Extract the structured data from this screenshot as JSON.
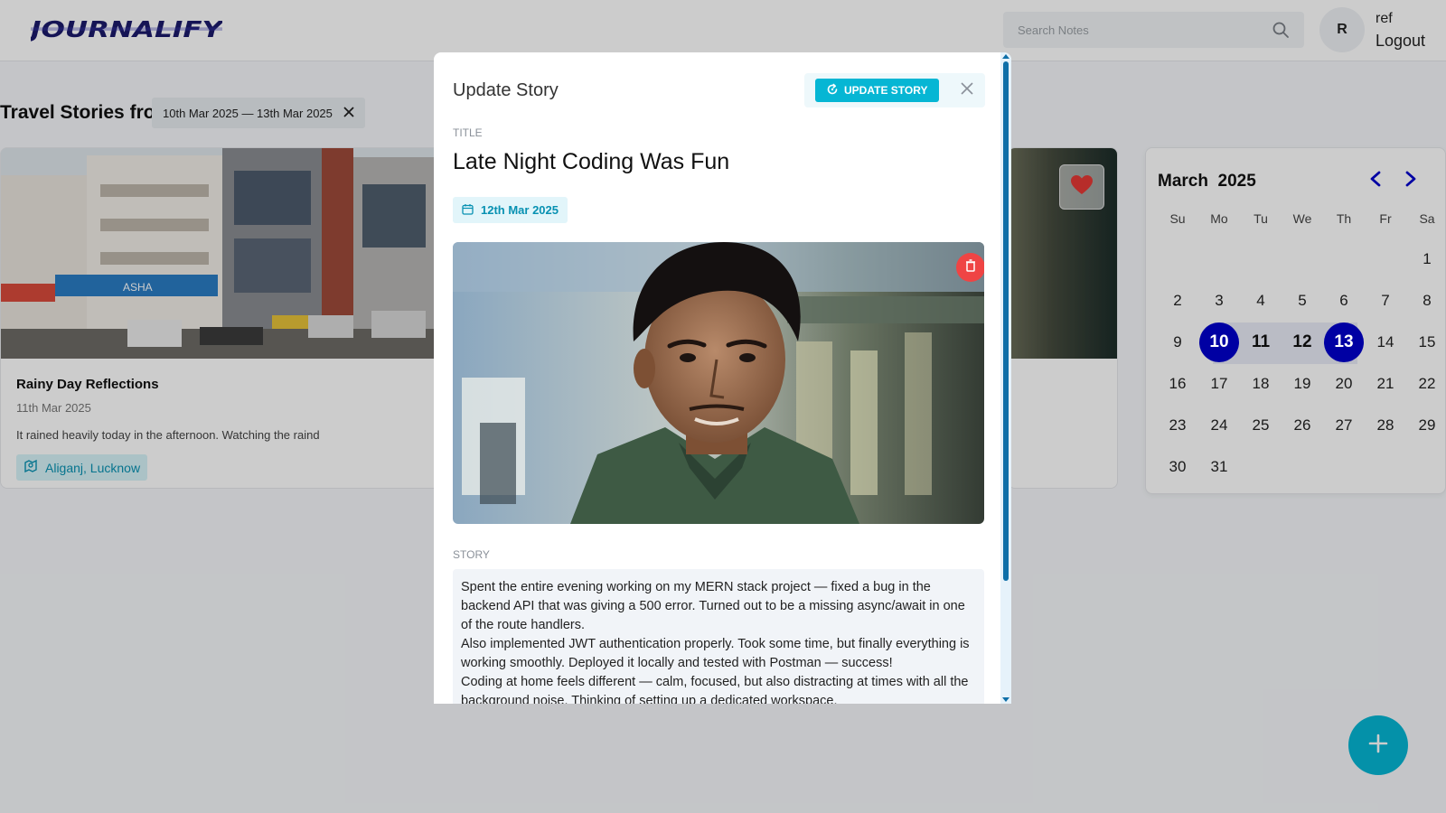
{
  "navbar": {
    "logo": "JOURNALIFY",
    "search_placeholder": "Search Notes",
    "avatar_initial": "R",
    "user_name": "ref",
    "logout_label": "Logout"
  },
  "filter": {
    "title": "Travel Stories from",
    "range_label": "10th Mar 2025 — 13th Mar 2025",
    "clear_icon": "close-icon"
  },
  "card": {
    "title": "Rainy Day Reflections",
    "date": "11th Mar 2025",
    "excerpt": "It rained heavily today in the afternoon. Watching the raind",
    "location": "Aliganj, Lucknow"
  },
  "calendar": {
    "month": "March",
    "year": "2025",
    "weekdays": [
      "Su",
      "Mo",
      "Tu",
      "We",
      "Th",
      "Fr",
      "Sa"
    ],
    "days": [
      "1",
      "2",
      "3",
      "4",
      "5",
      "6",
      "7",
      "8",
      "9",
      "10",
      "11",
      "12",
      "13",
      "14",
      "15",
      "16",
      "17",
      "18",
      "19",
      "20",
      "21",
      "22",
      "23",
      "24",
      "25",
      "26",
      "27",
      "28",
      "29",
      "30",
      "31"
    ],
    "range_start": "10",
    "range_end": "13",
    "accent": "#0000cc"
  },
  "modal": {
    "heading": "Update Story",
    "update_button": "UPDATE STORY",
    "title_label": "TITLE",
    "title_value": "Late Night Coding Was Fun",
    "date_value": "12th Mar 2025",
    "story_label": "STORY",
    "story_paragraphs": [
      "Spent the entire evening working on my MERN stack project — fixed a bug in the backend API that was giving a 500 error. Turned out to be a missing async/await in one of the route handlers.",
      "Also implemented JWT authentication properly. Took some time, but finally everything is working smoothly. Deployed it locally and tested with Postman — success!",
      "Coding at home feels different — calm, focused, but also distracting at times with all the background noise. Thinking of setting up a dedicated workspace."
    ]
  },
  "colors": {
    "accent": "#06b6d4",
    "danger": "#ef4444",
    "calendar_selected": "#0000cc"
  }
}
